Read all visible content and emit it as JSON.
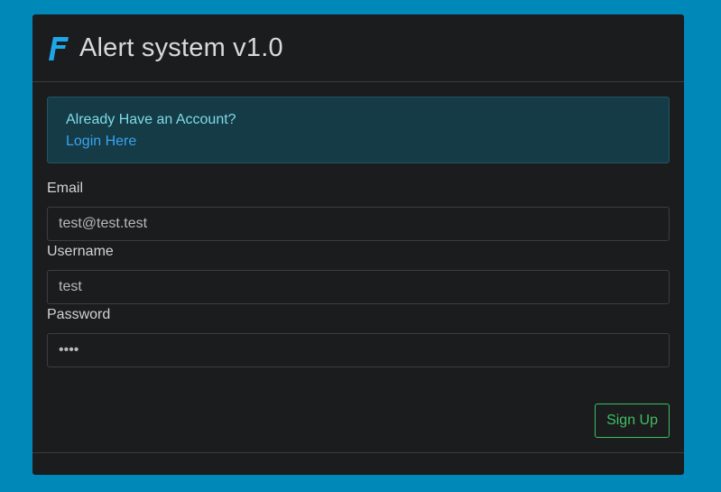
{
  "header": {
    "logo_icon": "brand-f-icon",
    "title": "Alert system v1.0"
  },
  "info": {
    "text": "Already Have an Account?",
    "link": "Login Here"
  },
  "form": {
    "email": {
      "label": "Email",
      "value": "test@test.test"
    },
    "username": {
      "label": "Username",
      "value": "test"
    },
    "password": {
      "label": "Password",
      "value": "test"
    }
  },
  "actions": {
    "signup_label": "Sign Up"
  },
  "colors": {
    "background": "#0088b8",
    "card": "#1b1c1e",
    "accent_logo": "#1ea7e8",
    "info_bg": "#143b46",
    "link": "#3aa3f0",
    "success": "#3fbf63"
  }
}
